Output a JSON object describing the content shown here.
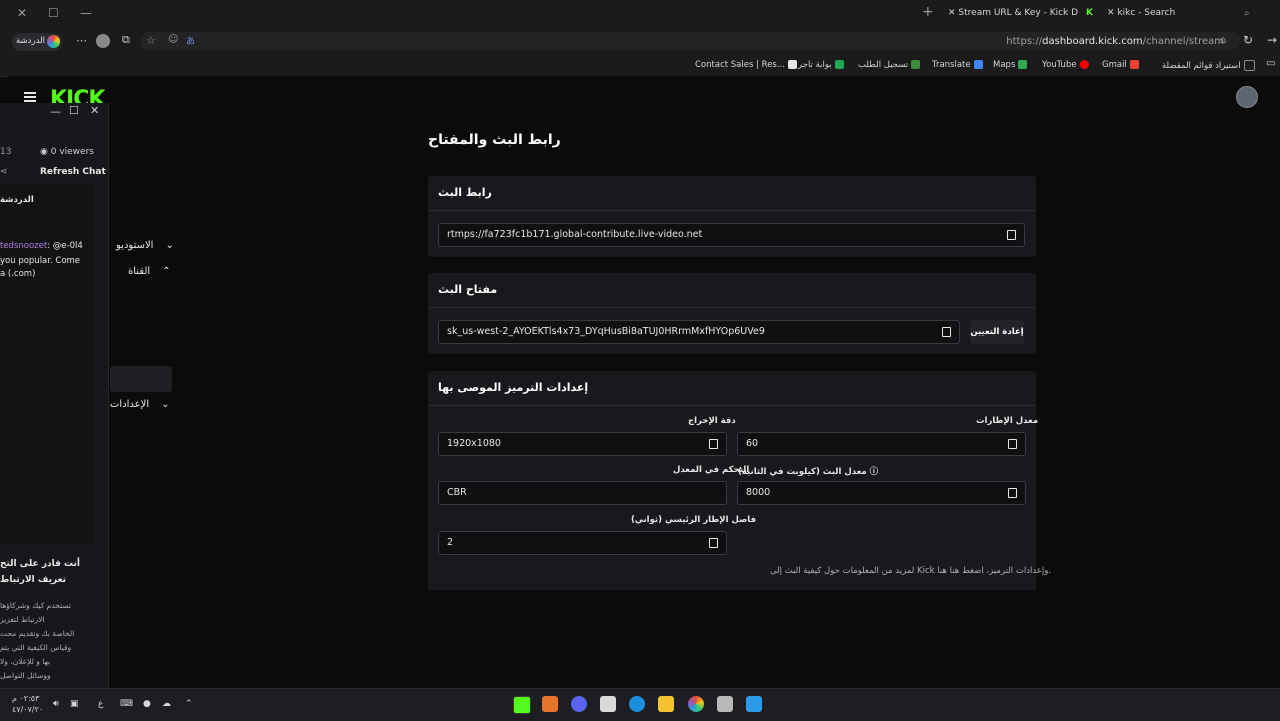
{
  "browser": {
    "tabs": [
      {
        "label": "Stream URL & Key - Kick Dashboard"
      },
      {
        "label": "kikc - Search"
      }
    ],
    "url_prefix": "https://",
    "url_host": "dashboard.kick.com",
    "url_path": "/channel/stream",
    "profile_label": "الدردشة",
    "bookmarks": [
      {
        "label": "Contact Sales | Res...",
        "icon": "dark-logo",
        "color": "#202020"
      },
      {
        "label": "بوابة تاجر",
        "icon": "check-logo",
        "color": "#1fa84f"
      },
      {
        "label": "تسجيل الطلب",
        "icon": "leaf-logo",
        "color": "#3c8b3c"
      },
      {
        "label": "Translate",
        "icon": "translate-logo",
        "color": "#4285f4"
      },
      {
        "label": "Maps",
        "icon": "maps-logo",
        "color": "#34a853"
      },
      {
        "label": "YouTube",
        "icon": "youtube-logo",
        "color": "#ff0000"
      },
      {
        "label": "Gmail",
        "icon": "gmail-logo",
        "color": "#ea4335"
      },
      {
        "label": "استيراد قوائم المفضلة",
        "icon": "import-icon",
        "color": "#8a8a8a"
      }
    ]
  },
  "app": {
    "logo": "KICK",
    "sidebar": {
      "studio": "الاستوديو",
      "channel": "القناة",
      "settings": "الإعدادات"
    }
  },
  "chat": {
    "count": "13",
    "viewers": "0 viewers",
    "refresh": "Refresh Chat",
    "title": "الدردشة",
    "msg_user": "tedsnoozet",
    "msg_line1": ": @e-0l4",
    "msg_line2": "you popular. Come",
    "msg_line3": "a (.com)",
    "promo_title_1": "أنت قادر على التح",
    "promo_title_2": "تعريف الارتباط",
    "promo_body_1": "تستخدم كيك وشركاؤها",
    "promo_body_2": "الارتباط لتعزيز",
    "promo_body_3": "الخاصة بك وتقديم محت",
    "promo_body_4": "وقياس الكيفية التي يتم",
    "promo_body_5": "بها و للإعلان، ولا",
    "promo_body_6": "ووسائل التواصل"
  },
  "main": {
    "page_title": "رابط البث والمفتاح",
    "url_card": {
      "title": "رابط البث",
      "value": "rtmps://fa723fc1b171.global-contribute.live-video.net"
    },
    "key_card": {
      "title": "مفتاح البث",
      "value": "sk_us-west-2_AYOEKTls4x73_DYqHusBi8aTUJ0HRrmMxfHYOp6UVe9",
      "reset": "إعادة التعيين"
    },
    "encoding_card": {
      "title": "إعدادات الترميز الموصى بها",
      "resolution_label": "دقة الإخراج",
      "resolution": "1920x1080",
      "framerate_label": "معدل الإطارات",
      "framerate": "60",
      "ratecontrol_label": "التحكم في المعدل",
      "ratecontrol": "CBR",
      "bitrate_label": "معدل البث (كيلوبت في الثانية)",
      "bitrate": "8000",
      "keyframe_label": "فاصل الإطار الرئيسي (ثواني)",
      "keyframe": "2",
      "info": "لمزيد من المعلومات حول كيفية البث إلى Kick وإعدادات الترميز، اضغط هنا هنا."
    }
  },
  "taskbar": {
    "time": "٠٢:٥٣ م",
    "date": "٤٧/٠٧/٢٠",
    "lang": "ع"
  }
}
